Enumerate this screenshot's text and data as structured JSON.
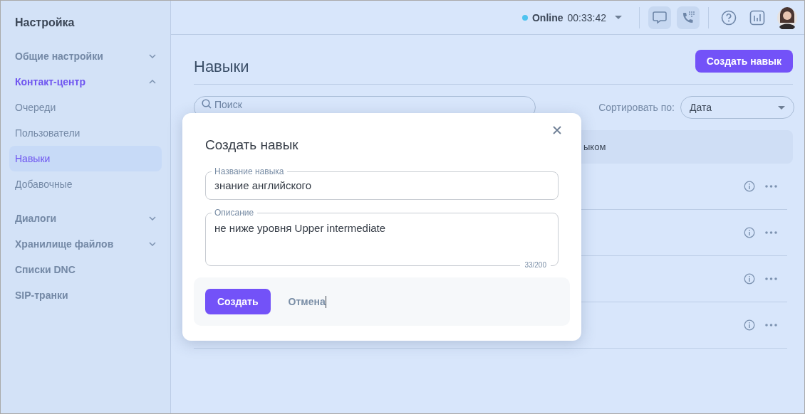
{
  "sidebar": {
    "title": "Настройка",
    "items": [
      {
        "kind": "group",
        "label": "Общие настройки",
        "expanded": false
      },
      {
        "kind": "group",
        "label": "Контакт-центр",
        "expanded": true,
        "children": [
          {
            "label": "Очереди",
            "selected": false
          },
          {
            "label": "Пользователи",
            "selected": false
          },
          {
            "label": "Навыки",
            "selected": true
          },
          {
            "label": "Добавочные",
            "selected": false
          }
        ]
      },
      {
        "kind": "group",
        "label": "Диалоги",
        "expanded": false
      },
      {
        "kind": "group",
        "label": "Хранилище файлов",
        "expanded": false
      },
      {
        "kind": "link",
        "label": "Списки DNC"
      },
      {
        "kind": "link",
        "label": "SIP-транки"
      }
    ]
  },
  "topbar": {
    "status": {
      "label": "Online",
      "timer": "00:33:42",
      "color": "#4fc3ef"
    }
  },
  "page": {
    "title": "Навыки",
    "create_button": "Создать навык",
    "search": {
      "placeholder": "Поиск"
    },
    "sort": {
      "label": "Сортировать по:",
      "value": "Дата"
    },
    "table": {
      "header_text": "ыком",
      "rows": [
        {
          "kind": "actions"
        },
        {
          "kind": "actions"
        },
        {
          "kind": "actions"
        },
        {
          "kind": "actions"
        }
      ]
    }
  },
  "modal": {
    "title": "Создать навык",
    "fields": [
      {
        "kind": "input",
        "label": "Название навыка",
        "value": "знание английского"
      },
      {
        "kind": "textarea",
        "label": "Описание",
        "value": "не ниже уровня Upper intermediate",
        "counter": "33/200"
      }
    ],
    "buttons": [
      {
        "kind": "primary",
        "label": "Создать"
      },
      {
        "kind": "link",
        "label": "Отмена"
      }
    ]
  }
}
